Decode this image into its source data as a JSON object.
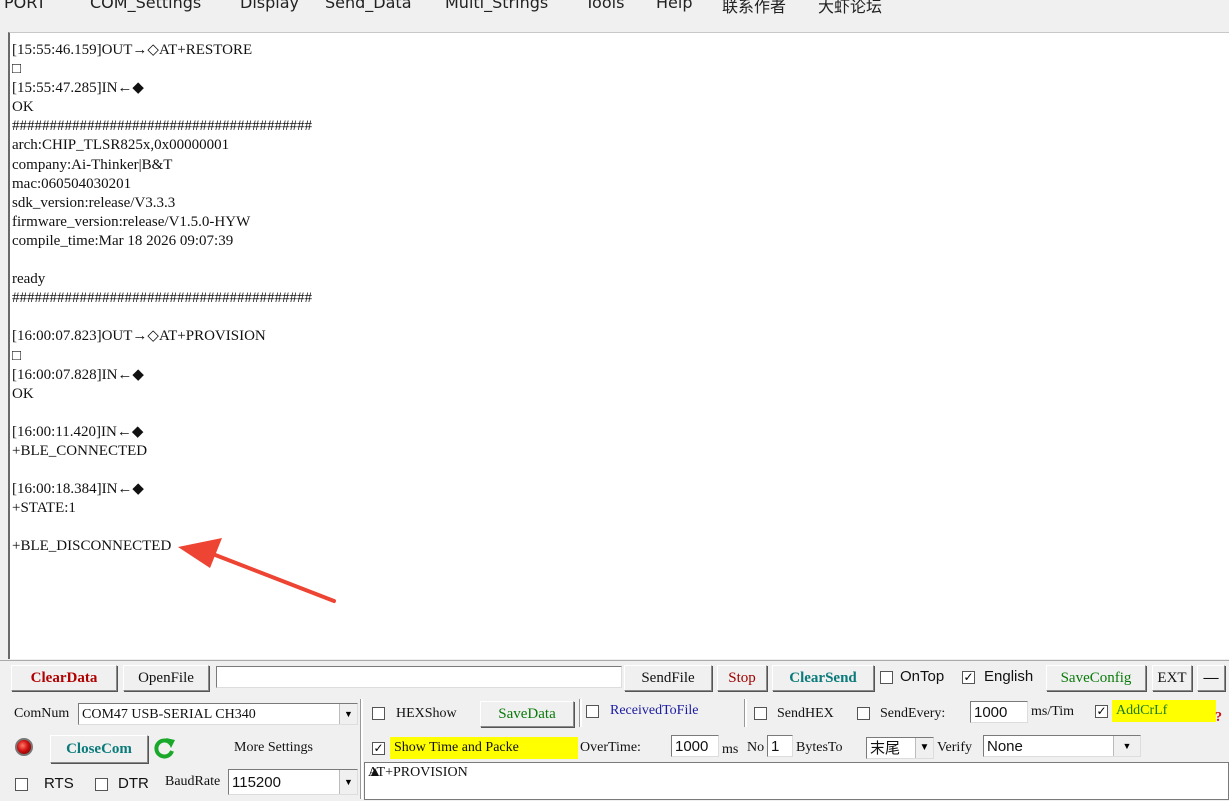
{
  "menu": [
    {
      "label": "PORT"
    },
    {
      "label": "COM_Settings"
    },
    {
      "label": "Display"
    },
    {
      "label": "Send_Data"
    },
    {
      "label": "Multi_Strings"
    },
    {
      "label": "Tools"
    },
    {
      "label": "Help"
    },
    {
      "label": "联系作者"
    },
    {
      "label": "大虾论坛"
    }
  ],
  "log": {
    "text": "[15:55:46.159]OUT→◇AT+RESTORE\n□\n[15:55:47.285]IN←◆\nOK\n########################################\narch:CHIP_TLSR825x,0x00000001\ncompany:Ai-Thinker|B&T\nmac:060504030201\nsdk_version:release/V3.3.3\nfirmware_version:release/V1.5.0-HYW\ncompile_time:Mar 18 2026 09:07:39\n\nready\n########################################\n\n[16:00:07.823]OUT→◇AT+PROVISION\n□\n[16:00:07.828]IN←◆\nOK\n\n[16:00:11.420]IN←◆\n+BLE_CONNECTED\n\n[16:00:18.384]IN←◆\n+STATE:1\n\n+BLE_DISCONNECTED"
  },
  "toolbar": {
    "clear_data": "ClearData",
    "open_file": "OpenFile",
    "file_path": "",
    "send_file": "SendFile",
    "stop": "Stop",
    "clear_send": "ClearSend",
    "on_top": {
      "label": "OnTop",
      "checked": false
    },
    "english": {
      "label": "English",
      "checked": true
    },
    "save_config": "SaveConfig",
    "ext": "EXT",
    "collapse": "—"
  },
  "port": {
    "com_num_label": "ComNum",
    "com_num_value": "COM47 USB-SERIAL CH340",
    "close_com": "CloseCom",
    "more_settings": "More Settings",
    "rts": {
      "label": "RTS",
      "checked": false
    },
    "dtr": {
      "label": "DTR",
      "checked": false
    },
    "baud_label": "BaudRate",
    "baud_value": "115200"
  },
  "options": {
    "hex_show": {
      "label": "HEXShow",
      "checked": false
    },
    "save_data": "SaveData",
    "received_to_file": {
      "label": "ReceivedToFile",
      "checked": false
    },
    "send_hex": {
      "label": "SendHEX",
      "checked": false
    },
    "send_every": {
      "label": "SendEvery:",
      "checked": false
    },
    "send_every_value": "1000",
    "send_every_unit": "ms/Tim",
    "add_crlf": {
      "label": "AddCrLf",
      "checked": true
    },
    "show_time": {
      "label": "Show Time and Packe",
      "checked": true
    },
    "overtime_label": "OverTime:",
    "overtime_value": "1000",
    "overtime_unit": "ms",
    "no_label": "No",
    "no_value": "1",
    "bytes_to_label": "BytesTo",
    "bytes_to_value": "末尾",
    "verify_label": "Verify",
    "verify_value": "None",
    "help_mark": "?"
  },
  "send": {
    "text": "AT+PROVISION"
  }
}
